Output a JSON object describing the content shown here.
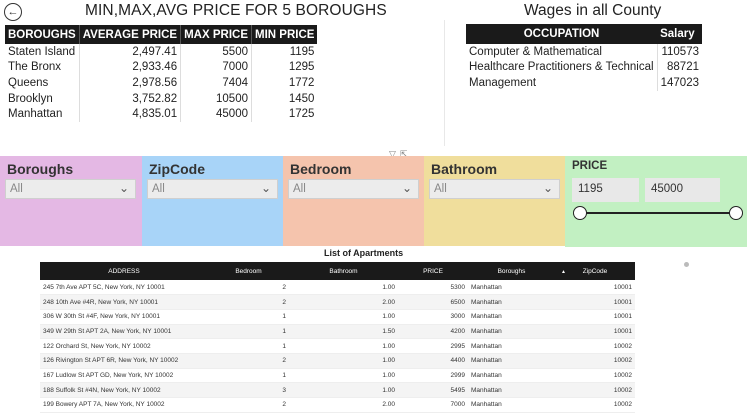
{
  "header": {
    "back_icon": "arrow-left-circle-icon",
    "title_left": "MIN,MAX,AVG PRICE FOR 5 BOROUGHS",
    "title_right": "Wages in all County"
  },
  "price_table": {
    "columns": [
      "BOROUGHS",
      "AVERAGE PRICE",
      "MAX PRICE",
      "MIN PRICE"
    ],
    "rows": [
      [
        "Staten Island",
        "2,497.41",
        "5500",
        "1195"
      ],
      [
        "The Bronx",
        "2,933.46",
        "7000",
        "1295"
      ],
      [
        "Queens",
        "2,978.56",
        "7404",
        "1772"
      ],
      [
        "Brooklyn",
        "3,752.82",
        "10500",
        "1450"
      ],
      [
        "Manhattan",
        "4,835.01",
        "45000",
        "1725"
      ]
    ]
  },
  "wages_table": {
    "columns": [
      "OCCUPATION",
      "Salary"
    ],
    "rows": [
      [
        "Computer & Mathematical",
        "110573"
      ],
      [
        "Healthcare Practitioners & Technical",
        "88721"
      ],
      [
        "Management",
        "147023"
      ]
    ]
  },
  "slicers": [
    {
      "label": "Boroughs",
      "value": "All",
      "color": "#e4b8e4"
    },
    {
      "label": "ZipCode",
      "value": "All",
      "color": "#a8d4f8"
    },
    {
      "label": "Bedroom",
      "value": "All",
      "color": "#f5c4ad"
    },
    {
      "label": "Bathroom",
      "value": "All",
      "color": "#f0de9c"
    }
  ],
  "price_slicer": {
    "label": "PRICE",
    "min": "1195",
    "max": "45000",
    "color": "#c2f0c2"
  },
  "apartments": {
    "title": "List of Apartments",
    "columns": [
      "ADDRESS",
      "Bedroom",
      "Bathroom",
      "PRICE",
      "Boroughs",
      "ZipCode"
    ],
    "rows": [
      [
        "245 7th Ave APT 5C, New York, NY 10001",
        "2",
        "1.00",
        "5300",
        "Manhattan",
        "10001"
      ],
      [
        "248 10th Ave #4R, New York, NY 10001",
        "2",
        "2.00",
        "6500",
        "Manhattan",
        "10001"
      ],
      [
        "306 W 30th St #4F, New York, NY 10001",
        "1",
        "1.00",
        "3000",
        "Manhattan",
        "10001"
      ],
      [
        "349 W 29th St APT 2A, New York, NY 10001",
        "1",
        "1.50",
        "4200",
        "Manhattan",
        "10001"
      ],
      [
        "122 Orchard St, New York, NY 10002",
        "1",
        "1.00",
        "2995",
        "Manhattan",
        "10002"
      ],
      [
        "126 Rivington St APT 6R, New York, NY 10002",
        "2",
        "1.00",
        "4400",
        "Manhattan",
        "10002"
      ],
      [
        "167 Ludlow St APT GD, New York, NY 10002",
        "1",
        "1.00",
        "2999",
        "Manhattan",
        "10002"
      ],
      [
        "188 Suffolk St #4N, New York, NY 10002",
        "3",
        "1.00",
        "5495",
        "Manhattan",
        "10002"
      ],
      [
        "199 Bowery APT 7A, New York, NY 10002",
        "2",
        "2.00",
        "7000",
        "Manhattan",
        "10002"
      ]
    ]
  }
}
